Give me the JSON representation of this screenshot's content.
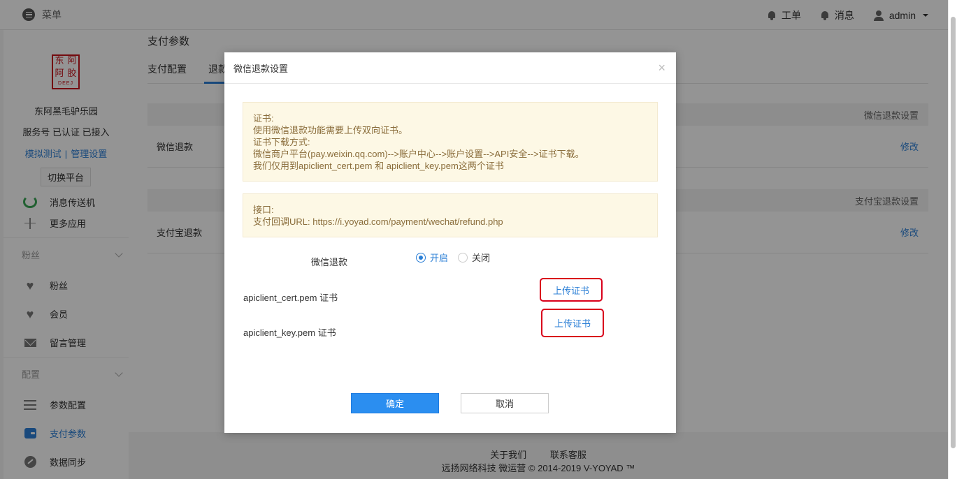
{
  "topbar": {
    "menu_label": "菜单",
    "ticket_label": "工单",
    "message_label": "消息",
    "user_label": "admin"
  },
  "sidebar": {
    "logo_chars": [
      "东",
      "阿",
      "阿",
      "胶"
    ],
    "logo_sub": "DEEJ",
    "account_name": "东阿黑毛驴乐园",
    "account_status": "服务号 已认证 已接入",
    "link_test": "模拟测试",
    "link_sep": "|",
    "link_manage": "管理设置",
    "switch_label": "切换平台",
    "items_top": [
      {
        "label": "消息传送机",
        "icon": "message-bot-icon"
      },
      {
        "label": "更多应用",
        "icon": "plus-icon"
      }
    ],
    "group_fans": "粉丝",
    "fans_items": [
      {
        "label": "粉丝",
        "icon": "heart-icon"
      },
      {
        "label": "会员",
        "icon": "heart-icon"
      },
      {
        "label": "留言管理",
        "icon": "mail-icon"
      }
    ],
    "group_config": "配置",
    "config_items": [
      {
        "label": "参数配置",
        "icon": "list-icon"
      },
      {
        "label": "支付参数",
        "icon": "wallet-icon"
      },
      {
        "label": "数据同步",
        "icon": "sync-icon"
      }
    ]
  },
  "main": {
    "page_title": "支付参数",
    "tabs": [
      "支付配置",
      "退款配置"
    ],
    "wechat_section_title": "微信退款设置",
    "wechat_row_label": "微信退款",
    "wechat_row_action": "修改",
    "alipay_section_title": "支付宝退款设置",
    "alipay_row_label": "支付宝退款",
    "alipay_row_action": "修改"
  },
  "footer": {
    "about": "关于我们",
    "contact": "联系客服",
    "copyright": "远扬网络科技 微运营 © 2014-2019 V-YOYAD ™"
  },
  "modal": {
    "title": "微信退款设置",
    "close_glyph": "×",
    "notice_cert": [
      "证书:",
      "使用微信退款功能需要上传双向证书。",
      "证书下载方式:",
      "微信商户平台(pay.weixin.qq.com)-->账户中心-->账户设置-->API安全-->证书下载。",
      "我们仅用到apiclient_cert.pem 和 apiclient_key.pem这两个证书"
    ],
    "notice_api": [
      "接口:",
      "支付回调URL: https://i.yoyad.com/payment/wechat/refund.php"
    ],
    "refund_label": "微信退款",
    "radio_on_label": "开启",
    "radio_off_label": "关闭",
    "refund_enabled": true,
    "cert_label": "apiclient_cert.pem 证书",
    "key_label": "apiclient_key.pem 证书",
    "upload_label": "上传证书",
    "ok_label": "确定",
    "cancel_label": "取消"
  },
  "colors": {
    "accent": "#2b7fd6",
    "primary_button": "#2b8ef0",
    "notice_bg": "#fdf8e5",
    "notice_text": "#8a6d3b",
    "highlight_border": "#d9001b",
    "logo_red": "#c8161d"
  }
}
